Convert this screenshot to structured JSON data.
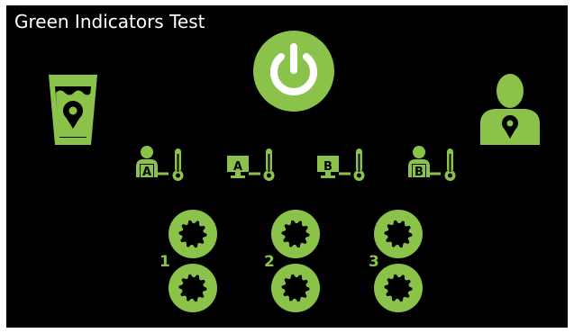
{
  "window": {
    "title": "Green Indicators Test"
  },
  "colors": {
    "accent": "#8bc34a",
    "background": "#000000",
    "text": "#ffffff"
  },
  "icons": {
    "power": "power-button-icon",
    "cup": "cup-location-icon",
    "user": "user-location-icon",
    "temp_sensors": [
      "person-thermometer-a-icon",
      "monitor-thermometer-a-icon",
      "monitor-thermometer-b-icon",
      "person-thermometer-b-icon"
    ],
    "gears": "gear-icon"
  },
  "sensors": [
    {
      "letter": "A"
    },
    {
      "letter": "A"
    },
    {
      "letter": "B"
    },
    {
      "letter": "B"
    }
  ],
  "gear_groups": [
    {
      "label": "1"
    },
    {
      "label": "2"
    },
    {
      "label": "3"
    }
  ]
}
